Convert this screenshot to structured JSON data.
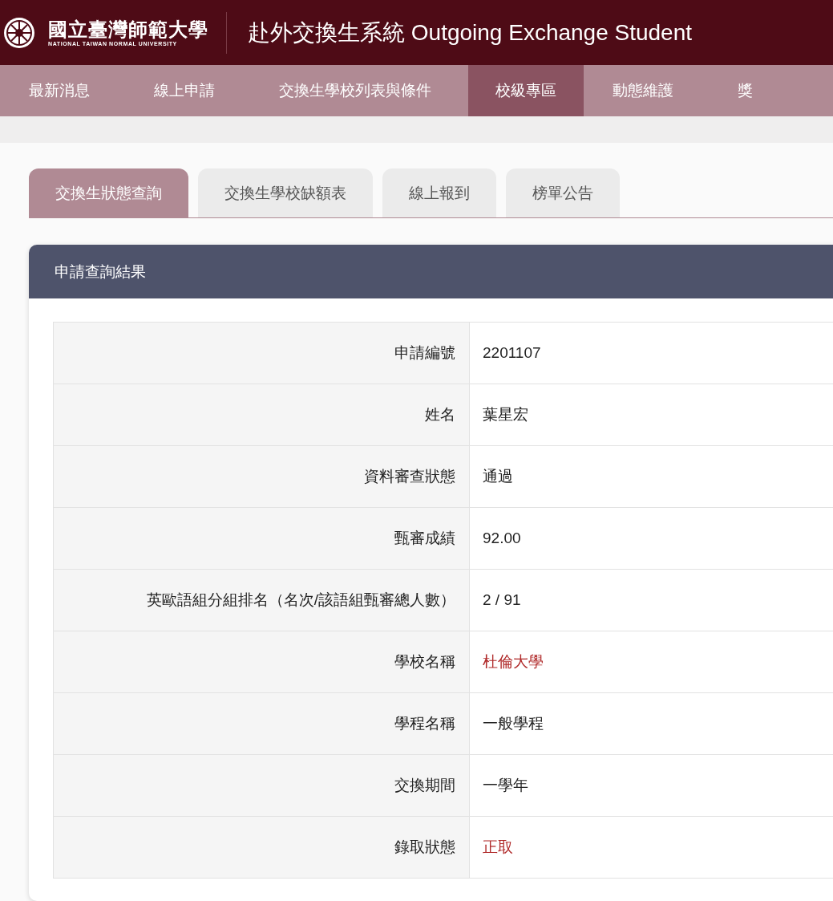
{
  "header": {
    "logo_name": "國立臺灣師範大學",
    "logo_subtitle": "NATIONAL TAIWAN NORMAL UNIVERSITY",
    "title": "赴外交換生系統 Outgoing Exchange Student"
  },
  "nav": [
    {
      "label": "最新消息",
      "selected": false
    },
    {
      "label": "線上申請",
      "selected": false
    },
    {
      "label": "交換生學校列表與條件",
      "selected": false
    },
    {
      "label": "校級專區",
      "selected": true
    },
    {
      "label": "動態維護",
      "selected": false
    },
    {
      "label": "獎",
      "selected": false
    }
  ],
  "tabs": [
    {
      "label": "交換生狀態查詢",
      "selected": true
    },
    {
      "label": "交換生學校缺額表",
      "selected": false
    },
    {
      "label": "線上報到",
      "selected": false
    },
    {
      "label": "榜單公告",
      "selected": false
    }
  ],
  "card": {
    "title": "申請查詢結果",
    "rows": [
      {
        "label": "申請編號",
        "value": "2201107",
        "emphasis": false
      },
      {
        "label": "姓名",
        "value": "葉星宏",
        "emphasis": false
      },
      {
        "label": "資料審查狀態",
        "value": "通過",
        "emphasis": false
      },
      {
        "label": "甄審成績",
        "value": "92.00",
        "emphasis": false
      },
      {
        "label": "英歐語組分組排名（名次/該語組甄審總人數）",
        "value": "2 / 91",
        "emphasis": false
      },
      {
        "label": "學校名稱",
        "value": "杜倫大學",
        "emphasis": true
      },
      {
        "label": "學程名稱",
        "value": "一般學程",
        "emphasis": false
      },
      {
        "label": "交換期間",
        "value": "一學年",
        "emphasis": false
      },
      {
        "label": "錄取狀態",
        "value": "正取",
        "emphasis": true
      }
    ]
  }
}
